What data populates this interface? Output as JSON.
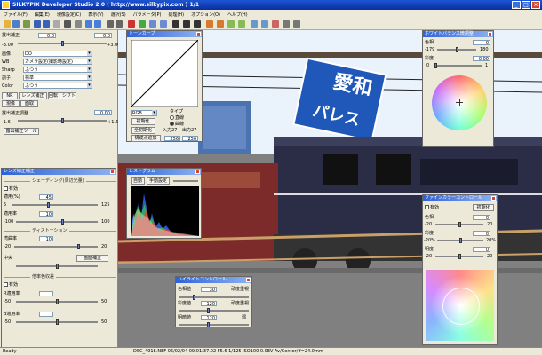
{
  "window": {
    "title": "SILKYPIX Developer Studio 2.0 ( http://www.silkypix.com ) 1/1"
  },
  "menu": [
    "ファイル(F)",
    "編集(E)",
    "現像設定(C)",
    "表示(V)",
    "選択(S)",
    "パラメータ(P)",
    "処理(H)",
    "オプション(O)",
    "ヘルプ(H)"
  ],
  "left": {
    "exposure": {
      "label": "露出補正",
      "value": "0.0",
      "spin": "0.0",
      "min": "-3.00",
      "max": "+3.00"
    },
    "wb": {
      "label": "WB",
      "value": "カメラ設定(撮影時設定)"
    },
    "image": {
      "label": "画像",
      "value": "DO"
    },
    "sharp": {
      "label": "Sharp",
      "value": "ふつう"
    },
    "tone": {
      "label": "調子",
      "value": "標準"
    },
    "color": {
      "label": "Color",
      "value": "ふつう"
    },
    "tabs": [
      "NR",
      "レンズ補正",
      "回転・シフト"
    ],
    "tabs2": [
      "現像",
      "面取"
    ],
    "exp_adjust": {
      "label": "露出補正調整",
      "value": "0.00",
      "min": "-1.6",
      "max": "+1.6"
    },
    "exp_tool_button": "露出補正ツール",
    "lens_panel": {
      "title": "レンズ補正補正",
      "shading": "シェーディング(周辺光量)",
      "valid1": "有効",
      "s1": {
        "label": "適用(%)",
        "value": "45",
        "min": "5",
        "max": "125"
      },
      "s2": {
        "label": "適用率",
        "value": "10",
        "min": "-100",
        "max": "100"
      },
      "distortion": "ディストーション",
      "s3": {
        "label": "湾曲率",
        "value": "10",
        "min": "-20",
        "max": "20"
      },
      "center": "中央",
      "auto_btn": "画面補正",
      "chroma": "倍率色収差",
      "valid2": "有効",
      "s4": {
        "label": "R適用率",
        "value": "",
        "min": "-50",
        "max": "50"
      },
      "s5": {
        "label": "B適用率",
        "value": "",
        "min": "-50",
        "max": "50"
      }
    }
  },
  "tone_panel": {
    "title": "トーンカーブ",
    "channel": "RGB",
    "type_label": "タイプ",
    "opt1": "直線",
    "opt2": "曲線",
    "init_btn": "初期化",
    "full_init_btn": "全初期化",
    "input_label": "入力27",
    "output_label": "出力27",
    "add_btn": "構成点追加",
    "v1": "256",
    "v2": "256"
  },
  "histogram_panel": {
    "title": "ヒストグラム",
    "auto": "自動",
    "manual": "手動設定"
  },
  "highlight_panel": {
    "title": "ハイライトコントロール",
    "r1": {
      "label": "色相値",
      "value": "30",
      "tail": "頑度重視"
    },
    "r2": {
      "label": "彩度値",
      "value": "120",
      "tail": "頑度重視"
    },
    "r3": {
      "label": "明暗値",
      "value": "120",
      "tail": "弱"
    }
  },
  "wb_panel": {
    "title": "ホワイトバランス微調整",
    "hue": {
      "label": "色相",
      "value": "0",
      "min": "-179",
      "max": "180"
    },
    "sat": {
      "label": "彩度",
      "value": "0.00",
      "min": "0",
      "max": "1"
    }
  },
  "fine_color_panel": {
    "title": "ファインカラーコントロール",
    "valid": "有効",
    "init_btn": "初期化",
    "hue": {
      "label": "色相",
      "value": "0",
      "min": "-20",
      "max": "20"
    },
    "sat": {
      "label": "彩度",
      "value": "0",
      "min": "-20%",
      "max": "20%"
    },
    "bri": {
      "label": "明度",
      "value": "0",
      "min": "-20",
      "max": "20"
    }
  },
  "photo_sign": {
    "line1": "愛",
    "line2": "和",
    "line3": "パレス"
  },
  "status": {
    "ready": "Ready",
    "info": "DSC_4918.NEF 06/02/04 09:01:37.02 F5.6 1/125 ISO100 0.0EV Av/Center/ f=24.0mm"
  },
  "colors": {
    "titlebar": "#0a2f9c",
    "panel": "#ece9d8",
    "sky": "#eaf2fb",
    "train_body": "#2a2d45"
  }
}
